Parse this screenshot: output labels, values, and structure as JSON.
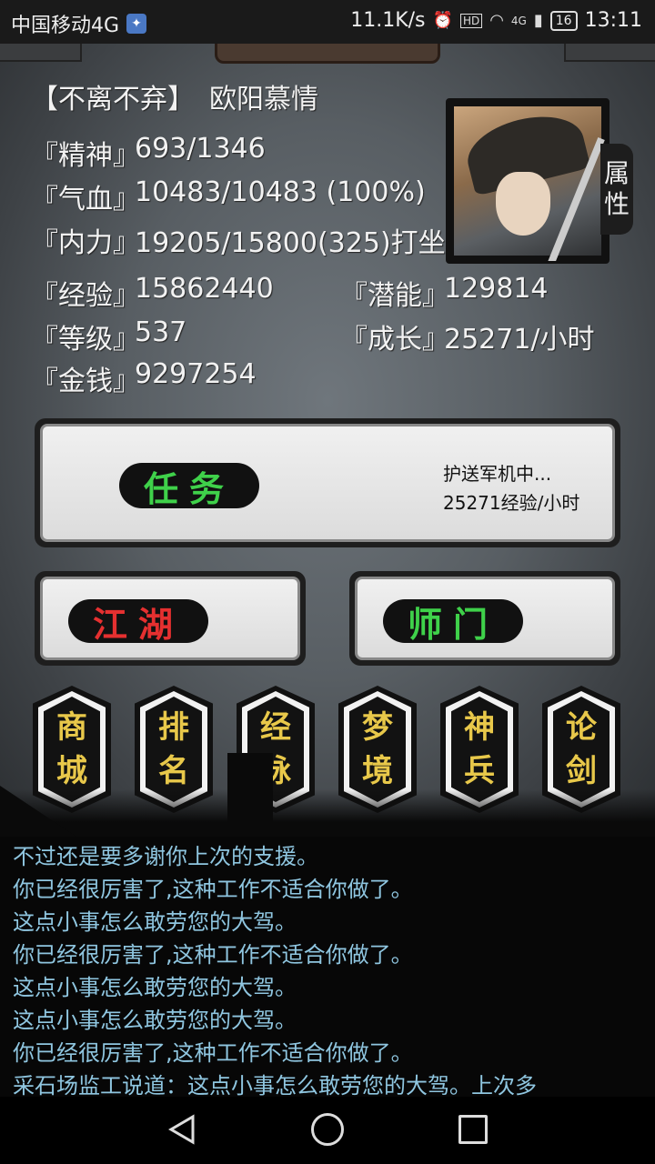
{
  "status_bar": {
    "carrier": "中国移动4G",
    "speed": "11.1K/s",
    "network": "4G",
    "battery": "16",
    "time": "13:11"
  },
  "character": {
    "title": "【不离不弃】",
    "name": "欧阳慕情",
    "attr_tab": [
      "属",
      "性"
    ],
    "stats": {
      "jingshen_label": "『精神』",
      "jingshen_value": "693/1346",
      "qixue_label": "『气血』",
      "qixue_value": "10483/10483 (100%)",
      "neili_label": "『内力』",
      "neili_value": "19205/15800(325)打坐",
      "jingyan_label": "『经验』",
      "jingyan_value": "15862440",
      "qianneng_label": "『潜能』",
      "qianneng_value": "129814",
      "dengji_label": "『等级』",
      "dengji_value": "537",
      "chengzhang_label": "『成长』",
      "chengzhang_value": "25271/小时",
      "jinqian_label": "『金钱』",
      "jinqian_value": "9297254"
    }
  },
  "buttons": {
    "task": "任务",
    "task_status": "护送军机中...",
    "task_rate": "25271经验/小时",
    "jianghu": "江湖",
    "shimen": "师门"
  },
  "hex_buttons": [
    {
      "top": "商",
      "bottom": "城"
    },
    {
      "top": "排",
      "bottom": "名"
    },
    {
      "top": "经",
      "bottom": "脉"
    },
    {
      "top": "梦",
      "bottom": "境"
    },
    {
      "top": "神",
      "bottom": "兵"
    },
    {
      "top": "论",
      "bottom": "剑"
    }
  ],
  "log": [
    "不过还是要多谢你上次的支援。",
    "你已经很厉害了,这种工作不适合你做了。",
    "这点小事怎么敢劳您的大驾。",
    "你已经很厉害了,这种工作不适合你做了。",
    "这点小事怎么敢劳您的大驾。",
    "这点小事怎么敢劳您的大驾。",
    "你已经很厉害了,这种工作不适合你做了。",
    "采石场监工说道：这点小事怎么敢劳您的大驾。上次多"
  ],
  "colors": {
    "task_green": "#3fd14a",
    "jianghu_red": "#e53030",
    "shimen_green": "#3fd14a",
    "hex_gold": "#e8c84a",
    "log_blue": "#8fc6e0"
  }
}
